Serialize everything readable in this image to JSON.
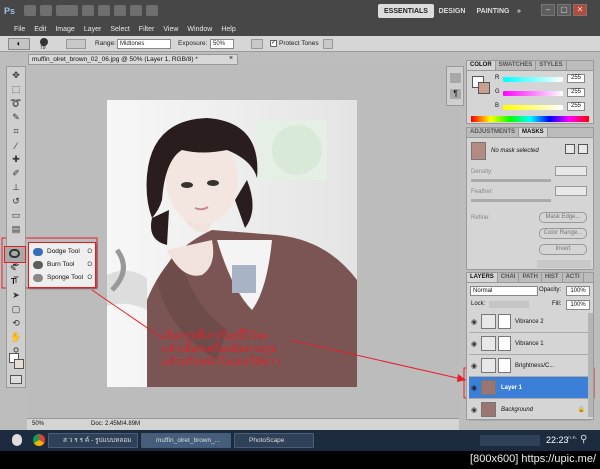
{
  "titlebar": {
    "app_logo": "Ps",
    "workspaces": [
      "ESSENTIALS",
      "DESIGN",
      "PAINTING",
      "»"
    ],
    "window_controls": [
      "–",
      "▢",
      "✕"
    ]
  },
  "menu": [
    "File",
    "Edit",
    "Image",
    "Layer",
    "Select",
    "Filter",
    "View",
    "Window",
    "Help"
  ],
  "options": {
    "brush_size": "79",
    "range_label": "Range:",
    "range_value": "Midtones",
    "exposure_label": "Exposure:",
    "exposure_value": "50%",
    "protect_tones_label": "Protect Tones"
  },
  "document": {
    "tab_title": "muffin_olret_brown_02_06.jpg @ 50% (Layer 1, RGB/8) *",
    "zoom": "50%",
    "doc_size": "Doc: 2.45M/4.89M"
  },
  "flyout": {
    "items": [
      {
        "label": "Dodge Tool",
        "key": "O"
      },
      {
        "label": "Burn Tool",
        "key": "O"
      },
      {
        "label": "Sponge Tool",
        "key": "O"
      }
    ]
  },
  "caption": {
    "line1": "เลือกรูปที่เราก๊อปปี้ไว้นะ",
    "line2": "แล้วเลือกเครื่องมือตามรูป",
    "line3": "แล้วปรับหน้าโมเดลให้ขาว"
  },
  "color_panel": {
    "tabs": [
      "COLOR",
      "SWATCHES",
      "STYLES"
    ],
    "channels": [
      {
        "name": "R",
        "value": "255"
      },
      {
        "name": "G",
        "value": "255"
      },
      {
        "name": "B",
        "value": "255"
      }
    ]
  },
  "adjust_panel": {
    "tabs": [
      "ADJUSTMENTS",
      "MASKS"
    ],
    "mask_text": "No mask selected",
    "density_label": "Density:",
    "feather_label": "Feather:",
    "refine_label": "Refine:",
    "buttons": [
      "Mask Edge...",
      "Color Range...",
      "Invert"
    ]
  },
  "layers_panel": {
    "tabs": [
      "LAYERS",
      "CHAI",
      "PATH",
      "HIST",
      "ACTI"
    ],
    "blend_mode": "Normal",
    "opacity_label": "Opacity:",
    "opacity_value": "100%",
    "lock_label": "Lock:",
    "fill_label": "Fill:",
    "fill_value": "100%",
    "layers": [
      {
        "name": "Vibrance 2",
        "selected": false
      },
      {
        "name": "Vibrance 1",
        "selected": false
      },
      {
        "name": "Brightness/C...",
        "selected": false
      },
      {
        "name": "Layer 1",
        "selected": true
      },
      {
        "name": "Background",
        "selected": false
      }
    ]
  },
  "taskbar": {
    "items": [
      "ส ว ร ร ค์ - รูปแบบหลอม ก...",
      "muffin_olret_brown_...",
      "PhotoScape"
    ],
    "clock": "22:23",
    "ampm": "ก.ค."
  },
  "watermark": "[800x600] https://upic.me/",
  "colors": {
    "accent_red": "#e61f2b",
    "selection_blue": "#3c7fd8",
    "chrome_dark": "#474747"
  }
}
